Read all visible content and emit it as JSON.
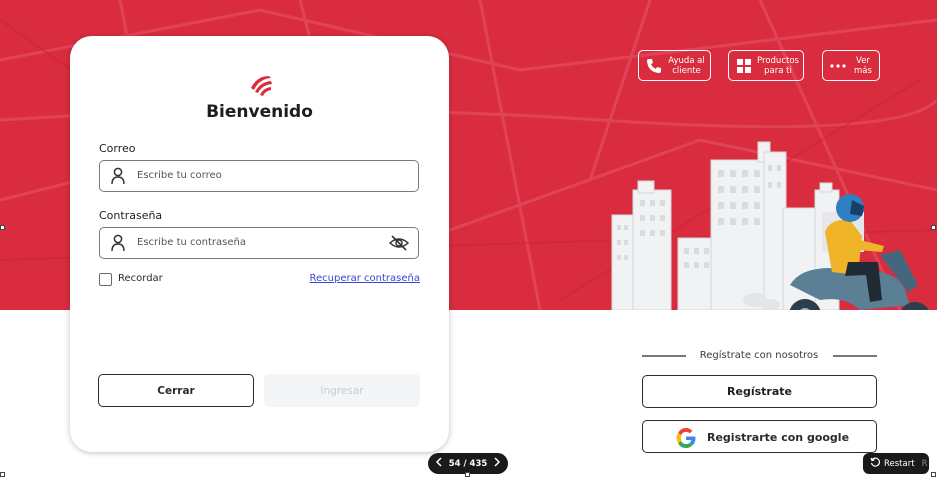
{
  "header": {
    "help_label": "Ayuda al cliente",
    "products_label": "Productos para ti",
    "more_label": "Ver más"
  },
  "login": {
    "title": "Bienvenido",
    "email_label": "Correo",
    "email_placeholder": "Escribe tu correo",
    "password_label": "Contraseña",
    "password_placeholder": "Escribe tu contraseña",
    "remember_label": "Recordar",
    "recover_link": "Recuperar contraseña",
    "close_button": "Cerrar",
    "login_button": "Ingresar"
  },
  "register": {
    "caption": "Regístrate con nosotros",
    "register_button": "Regístrate",
    "google_button": "Registrarte con google"
  },
  "pager": {
    "text": "54 / 435"
  },
  "restart": {
    "label": "Restart",
    "key": "R"
  },
  "colors": {
    "brand_red": "#d92d3f",
    "link_blue": "#3a46d6",
    "rider_jacket": "#f0b429"
  },
  "icons": [
    "phone-icon",
    "grid-icon",
    "dots-icon",
    "user-icon",
    "eye-off-icon",
    "google-icon",
    "restart-icon",
    "chevron-left-icon",
    "chevron-right-icon"
  ]
}
